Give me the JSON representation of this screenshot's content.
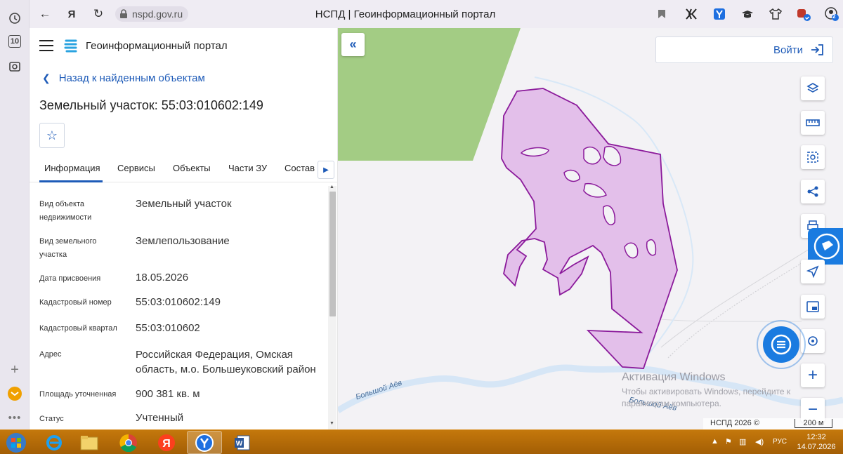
{
  "browser": {
    "url": "nspd.gov.ru",
    "page_title": "НСПД | Геоинформационный портал",
    "rail_tab_count": "10",
    "extension_badge": "2"
  },
  "panel": {
    "portal_name": "Геоинформационный портал",
    "back_link": "Назад к найденным объектам",
    "object_title": "Земельный участок: 55:03:010602:149",
    "tabs": [
      "Информация",
      "Сервисы",
      "Объекты",
      "Части ЗУ",
      "Состав"
    ],
    "active_tab": "Информация",
    "fields": [
      {
        "label": "Вид объекта недвижимости",
        "value": "Земельный участок"
      },
      {
        "label": "Вид земельного участка",
        "value": "Землепользование"
      },
      {
        "label": "Дата присвоения",
        "value": "18.05.2026"
      },
      {
        "label": "Кадастровый номер",
        "value": "55:03:010602:149"
      },
      {
        "label": "Кадастровый квартал",
        "value": "55:03:010602"
      },
      {
        "label": "Адрес",
        "value": "Российская Федерация, Омская область, м.о. Большеуковский район"
      },
      {
        "label": "Площадь уточненная",
        "value": "900 381 кв. м"
      },
      {
        "label": "Статус",
        "value": "Учтенный"
      }
    ]
  },
  "map": {
    "login_label": "Войти",
    "river_label": "Большой Аёв",
    "watermark_title": "Активация Windows",
    "watermark_text": "Чтобы активировать Windows, перейдите к параметрам компьютера.",
    "copyright": "НСПД 2026 ©",
    "scale": "200 м",
    "colors": {
      "parcel_fill": "#e3bfea",
      "parcel_stroke": "#8b1a9b",
      "forest": "#a3cc84",
      "river": "#d8e8f7",
      "accent": "#1e5bb8"
    }
  },
  "taskbar": {
    "lang": "РУС",
    "time": "12:32",
    "date": "14.07.2026"
  }
}
